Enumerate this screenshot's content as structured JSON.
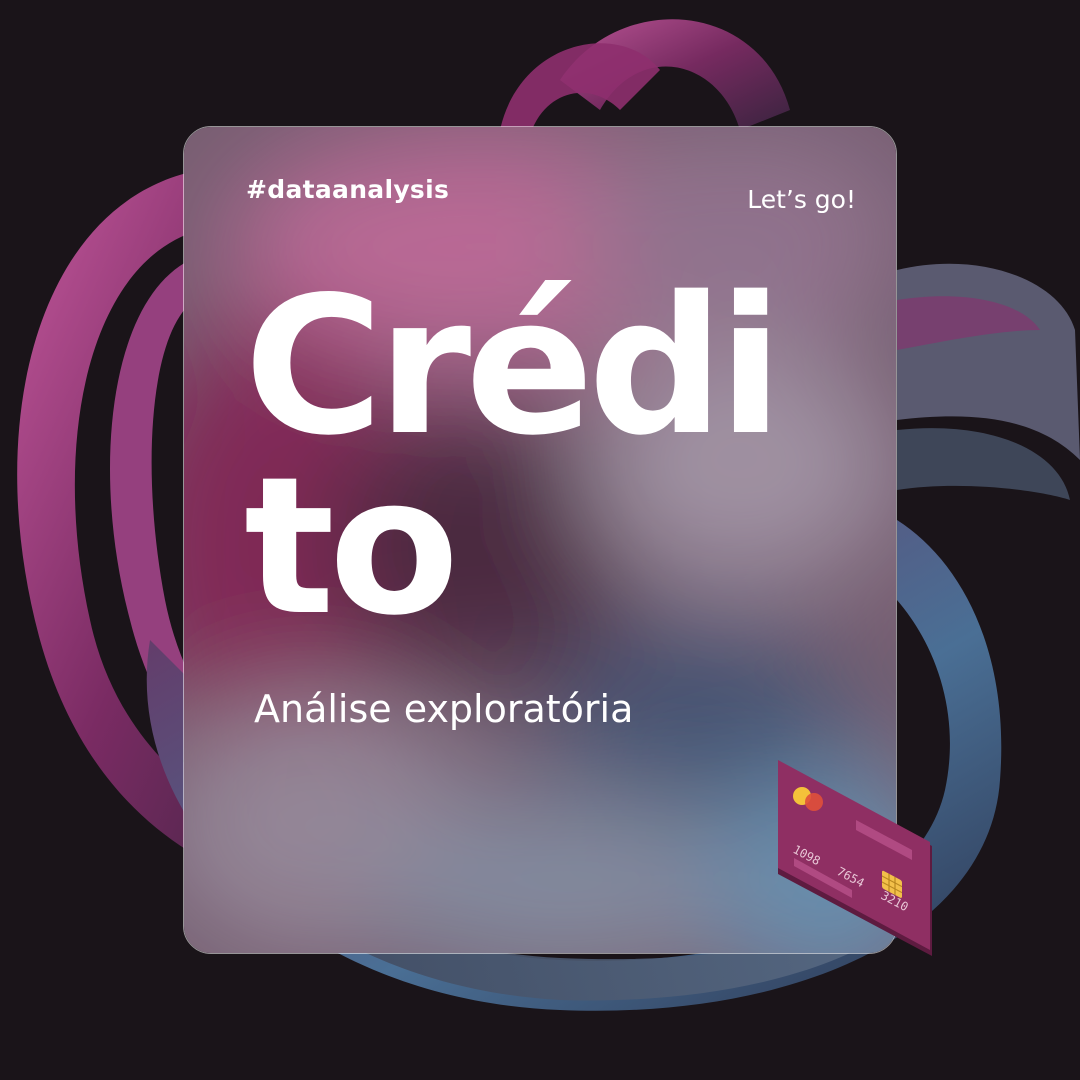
{
  "hashtag": "#dataanalysis",
  "cta": "Let’s go!",
  "title_line1": "Crédi",
  "title_line2": "to",
  "subtitle": "Análise exploratória",
  "card": {
    "number_groups": [
      "1098",
      "7654",
      "3210"
    ],
    "color": "#8f2f63",
    "logo_colors": [
      "#f4c23a",
      "#e0503a"
    ],
    "chip_color": "#f2c04a"
  },
  "colors": {
    "background": "#1a1419",
    "accent_magenta": "#b4508f",
    "accent_blue": "#6f8fb0",
    "text": "#ffffff"
  }
}
